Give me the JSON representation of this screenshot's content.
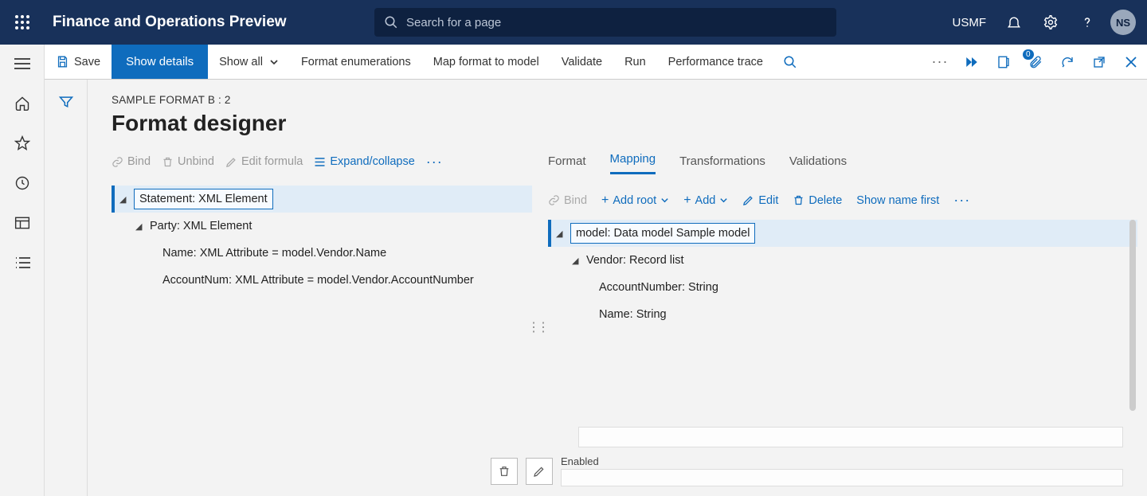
{
  "header": {
    "app_title": "Finance and Operations Preview",
    "search_placeholder": "Search for a page",
    "company": "USMF",
    "avatar_initials": "NS"
  },
  "actions": {
    "save": "Save",
    "show_details": "Show details",
    "show_all": "Show all",
    "format_enum": "Format enumerations",
    "map_format": "Map format to model",
    "validate": "Validate",
    "run": "Run",
    "perf_trace": "Performance trace",
    "attach_badge": "0"
  },
  "page": {
    "breadcrumb": "SAMPLE FORMAT B : 2",
    "title": "Format designer"
  },
  "left_toolbar": {
    "bind": "Bind",
    "unbind": "Unbind",
    "edit_formula": "Edit formula",
    "expand": "Expand/collapse"
  },
  "format_tree": {
    "root": "Statement: XML Element",
    "child1": "Party: XML Element",
    "leaf1": "Name: XML Attribute = model.Vendor.Name",
    "leaf2": "AccountNum: XML Attribute = model.Vendor.AccountNumber"
  },
  "tabs": {
    "format": "Format",
    "mapping": "Mapping",
    "transformations": "Transformations",
    "validations": "Validations"
  },
  "right_toolbar": {
    "bind": "Bind",
    "add_root": "Add root",
    "add": "Add",
    "edit": "Edit",
    "delete": "Delete",
    "show_name_first": "Show name first"
  },
  "model_tree": {
    "root": "model: Data model Sample model",
    "child1": "Vendor: Record list",
    "leaf1": "AccountNumber: String",
    "leaf2": "Name: String"
  },
  "bottom": {
    "enabled_label": "Enabled"
  }
}
